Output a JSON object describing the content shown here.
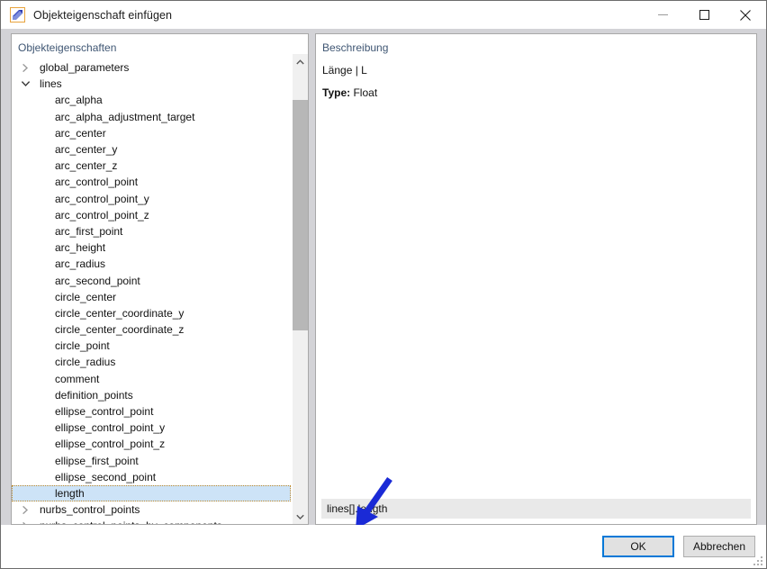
{
  "window": {
    "title": "Objekteigenschaft einfügen",
    "icon": "insert-property-icon",
    "controls": {
      "minimize": "minimize-icon",
      "maximize": "maximize-icon",
      "close": "close-icon"
    }
  },
  "tree_panel": {
    "header": "Objekteigenschaften",
    "selected": "length",
    "items": [
      {
        "label": "global_parameters",
        "type": "node",
        "expanded": false
      },
      {
        "label": "lines",
        "type": "node",
        "expanded": true
      },
      {
        "label": "arc_alpha",
        "type": "leaf"
      },
      {
        "label": "arc_alpha_adjustment_target",
        "type": "leaf"
      },
      {
        "label": "arc_center",
        "type": "leaf"
      },
      {
        "label": "arc_center_y",
        "type": "leaf"
      },
      {
        "label": "arc_center_z",
        "type": "leaf"
      },
      {
        "label": "arc_control_point",
        "type": "leaf"
      },
      {
        "label": "arc_control_point_y",
        "type": "leaf"
      },
      {
        "label": "arc_control_point_z",
        "type": "leaf"
      },
      {
        "label": "arc_first_point",
        "type": "leaf"
      },
      {
        "label": "arc_height",
        "type": "leaf"
      },
      {
        "label": "arc_radius",
        "type": "leaf"
      },
      {
        "label": "arc_second_point",
        "type": "leaf"
      },
      {
        "label": "circle_center",
        "type": "leaf"
      },
      {
        "label": "circle_center_coordinate_y",
        "type": "leaf"
      },
      {
        "label": "circle_center_coordinate_z",
        "type": "leaf"
      },
      {
        "label": "circle_point",
        "type": "leaf"
      },
      {
        "label": "circle_radius",
        "type": "leaf"
      },
      {
        "label": "comment",
        "type": "leaf"
      },
      {
        "label": "definition_points",
        "type": "leaf"
      },
      {
        "label": "ellipse_control_point",
        "type": "leaf"
      },
      {
        "label": "ellipse_control_point_y",
        "type": "leaf"
      },
      {
        "label": "ellipse_control_point_z",
        "type": "leaf"
      },
      {
        "label": "ellipse_first_point",
        "type": "leaf"
      },
      {
        "label": "ellipse_second_point",
        "type": "leaf"
      },
      {
        "label": "length",
        "type": "leaf",
        "selected": true
      },
      {
        "label": "nurbs_control_points",
        "type": "node",
        "expanded": false
      },
      {
        "label": "nurbs_control_points_by_components",
        "type": "node",
        "expanded": false
      }
    ],
    "scrollbar": {
      "up_arrow": "chevron-up-icon",
      "down_arrow": "chevron-down-icon"
    }
  },
  "description_panel": {
    "header": "Beschreibung",
    "name_line": "Länge | L",
    "type_label": "Type:",
    "type_value": "Float"
  },
  "result": {
    "value": "lines[].length"
  },
  "annotation": {
    "arrow": "blue-pointer-arrow",
    "color": "#1a2ad6"
  },
  "footer": {
    "ok_label": "OK",
    "cancel_label": "Abbrechen",
    "resize_grip": "resize-grip-icon"
  },
  "colors": {
    "dialog_background": "#d3d3d7",
    "panel_background": "#ffffff",
    "header_text": "#3f5673",
    "selection": "#cde3f7",
    "focus_border": "#0078d7",
    "scrollbar_thumb": "#b7b7b7",
    "result_field": "#e9e9e9"
  }
}
